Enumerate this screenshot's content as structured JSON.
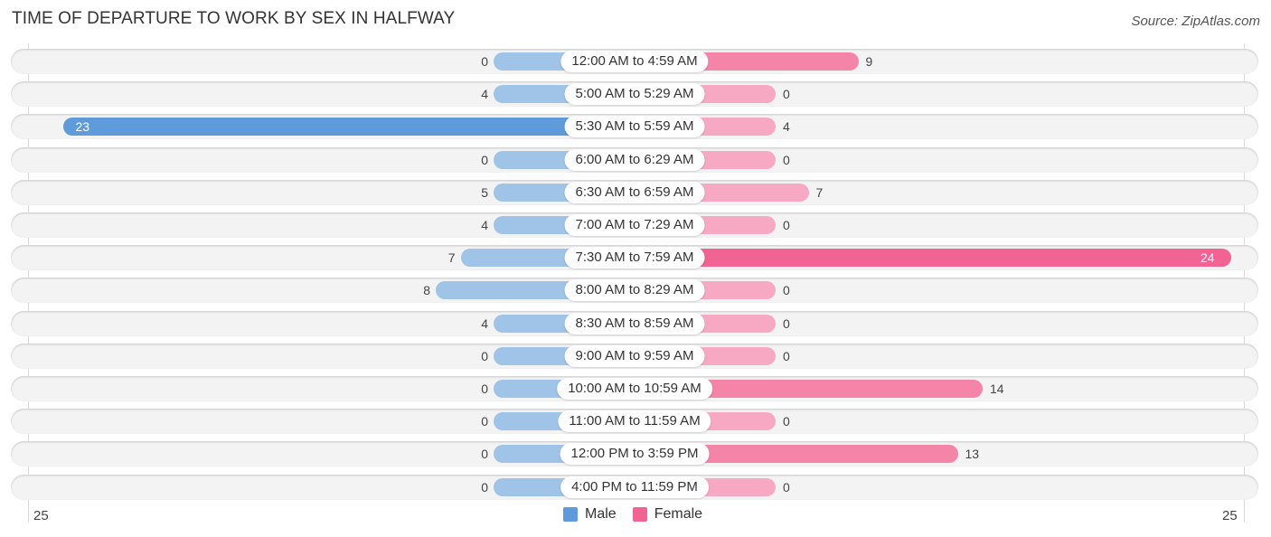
{
  "header": {
    "title": "TIME OF DEPARTURE TO WORK BY SEX IN HALFWAY",
    "source": "Source: ZipAtlas.com"
  },
  "colors": {
    "male": "#a0c3e8",
    "male_strong": "#5f9bdb",
    "female": "#f7a8c3",
    "female_strong": "#f06392",
    "row_bg": "#f3f3f3"
  },
  "chart_data": {
    "type": "bar",
    "orientation": "horizontal-diverging",
    "title": "TIME OF DEPARTURE TO WORK BY SEX IN HALFWAY",
    "categories": [
      "12:00 AM to 4:59 AM",
      "5:00 AM to 5:29 AM",
      "5:30 AM to 5:59 AM",
      "6:00 AM to 6:29 AM",
      "6:30 AM to 6:59 AM",
      "7:00 AM to 7:29 AM",
      "7:30 AM to 7:59 AM",
      "8:00 AM to 8:29 AM",
      "8:30 AM to 8:59 AM",
      "9:00 AM to 9:59 AM",
      "10:00 AM to 10:59 AM",
      "11:00 AM to 11:59 AM",
      "12:00 PM to 3:59 PM",
      "4:00 PM to 11:59 PM"
    ],
    "series": [
      {
        "name": "Male",
        "values": [
          0,
          4,
          23,
          0,
          5,
          4,
          7,
          8,
          4,
          0,
          0,
          0,
          0,
          0
        ]
      },
      {
        "name": "Female",
        "values": [
          9,
          0,
          4,
          0,
          7,
          0,
          24,
          0,
          0,
          0,
          14,
          0,
          13,
          0
        ]
      }
    ],
    "axis": {
      "left_tick": "25",
      "right_tick": "25",
      "range": [
        -25,
        25
      ]
    },
    "legend": {
      "entries": [
        "Male",
        "Female"
      ],
      "placement": "bottom-center"
    },
    "grid": false
  }
}
